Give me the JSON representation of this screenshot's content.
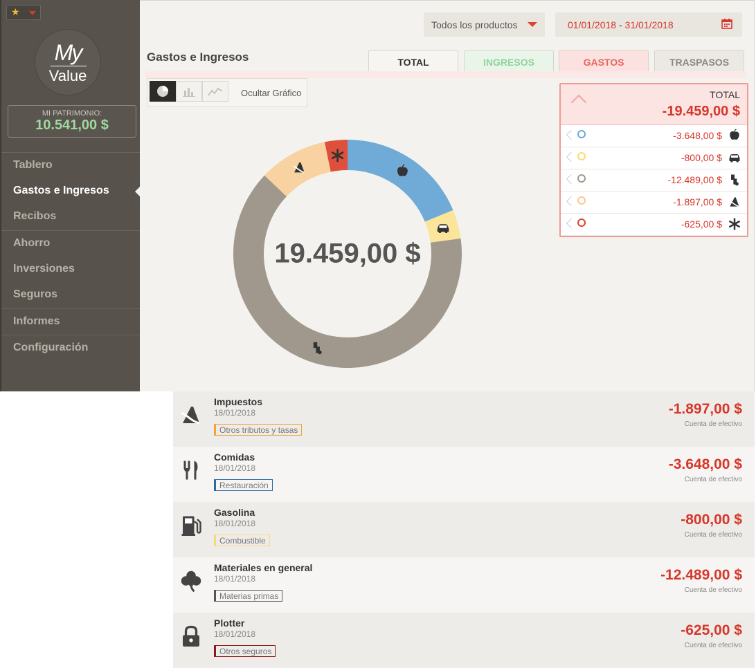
{
  "brand": {
    "logo_my": "My",
    "logo_value": "Value"
  },
  "patrimonio": {
    "label": "MI PATRIMONIO:",
    "value": "10.541,00 $"
  },
  "nav": [
    {
      "label": "Tablero",
      "active": false
    },
    {
      "label": "Gastos e Ingresos",
      "active": true
    },
    {
      "label": "Recibos",
      "active": false
    },
    {
      "label": "Ahorro",
      "active": false
    },
    {
      "label": "Inversiones",
      "active": false
    },
    {
      "label": "Seguros",
      "active": false
    },
    {
      "label": "Informes",
      "active": false
    },
    {
      "label": "Configuración",
      "active": false
    }
  ],
  "filters": {
    "products": "Todos los productos",
    "date_from": "01/01/2018",
    "date_sep": " - ",
    "date_to": "31/01/2018"
  },
  "page_title": "Gastos e Ingresos",
  "tabs": [
    {
      "label": "TOTAL",
      "color": "#333333",
      "bg": "#f7f5f2"
    },
    {
      "label": "INGRESOS",
      "color": "#8fd49a",
      "bg": "#eaf5ea"
    },
    {
      "label": "GASTOS",
      "color": "#e8675f",
      "bg": "#fbe2e0",
      "active": true
    },
    {
      "label": "TRASPASOS",
      "color": "#888888",
      "bg": "#ece9e4"
    }
  ],
  "chart_controls": {
    "hide_label": "Ocultar Gráfico"
  },
  "summary": {
    "total_label": "TOTAL",
    "total_value": "-19.459,00 $",
    "rows": [
      {
        "amount": "-3.648,00 $",
        "color": "#6aaad2",
        "icon": "apple-icon"
      },
      {
        "amount": "-800,00 $",
        "color": "#f7dc6f",
        "icon": "car-icon"
      },
      {
        "amount": "-12.489,00 $",
        "color": "#9e978c",
        "icon": "materials-icon"
      },
      {
        "amount": "-1.897,00 $",
        "color": "#f8c98c",
        "icon": "taxes-icon"
      },
      {
        "amount": "-625,00 $",
        "color": "#d9432f",
        "icon": "asterisk-icon"
      }
    ]
  },
  "chart_data": {
    "type": "pie",
    "center_label": "19.459,00 $",
    "slices": [
      {
        "value": 3648,
        "color": "#6fabd6",
        "icon": "apple-icon"
      },
      {
        "value": 800,
        "color": "#fbe59a",
        "icon": "car-icon"
      },
      {
        "value": 12489,
        "color": "#a0988d",
        "icon": "materials-icon"
      },
      {
        "value": 1897,
        "color": "#f8d2a0",
        "icon": "taxes-icon"
      },
      {
        "value": 625,
        "color": "#de503c",
        "icon": "asterisk-icon"
      }
    ]
  },
  "transactions": [
    {
      "name": "Impuestos",
      "date": "18/01/2018",
      "category": "Otros tributos y tasas",
      "cat_color": "#f2a43a",
      "amount": "-1.897,00 $",
      "account": "Cuenta de efectivo",
      "icon": "taxes-icon"
    },
    {
      "name": "Comidas",
      "date": "18/01/2018",
      "category": "Restauración",
      "cat_color": "#2d6aa0",
      "amount": "-3.648,00 $",
      "account": "Cuenta de efectivo",
      "icon": "cutlery-icon"
    },
    {
      "name": "Gasolina",
      "date": "18/01/2018",
      "category": "Combustible",
      "cat_color": "#f7d978",
      "amount": "-800,00 $",
      "account": "Cuenta de efectivo",
      "icon": "fuel-pump-icon"
    },
    {
      "name": "Materiales en general",
      "date": "18/01/2018",
      "category": "Materias primas",
      "cat_color": "#555555",
      "amount": "-12.489,00 $",
      "account": "Cuenta de efectivo",
      "icon": "clover-icon"
    },
    {
      "name": "Plotter",
      "date": "18/01/2018",
      "category": "Otros seguros",
      "cat_color": "#8a1a1a",
      "amount": "-625,00 $",
      "account": "Cuenta de efectivo",
      "icon": "lock-icon"
    }
  ]
}
